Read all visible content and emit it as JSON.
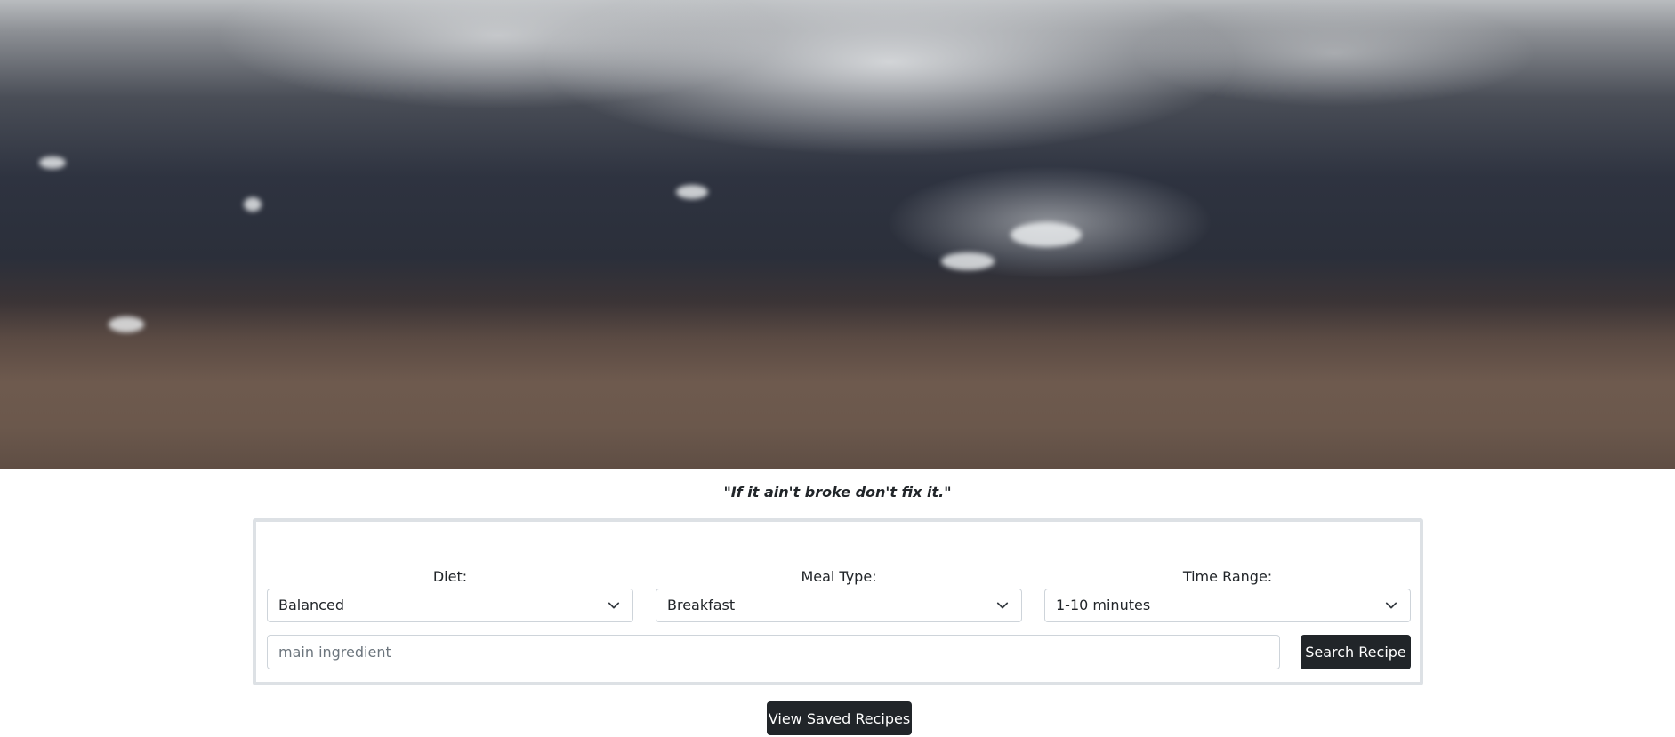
{
  "hero": {
    "image": "flour-on-dark-surface-photo"
  },
  "quote": "\"If it ain't broke don't fix it.\"",
  "search": {
    "diet": {
      "label": "Diet:",
      "selected": "Balanced"
    },
    "meal_type": {
      "label": "Meal Type:",
      "selected": "Breakfast"
    },
    "time_range": {
      "label": "Time Range:",
      "selected": "1-10 minutes"
    },
    "ingredient": {
      "placeholder": "main ingredient",
      "value": ""
    },
    "search_button": "Search Recipe"
  },
  "view_saved_button": "View Saved Recipes",
  "icons": {
    "dropdown": "chevron-down-icon"
  },
  "colors": {
    "button_bg": "#212529",
    "button_text": "#ffffff",
    "card_border": "#dde1e5",
    "input_border": "#ced4da"
  }
}
